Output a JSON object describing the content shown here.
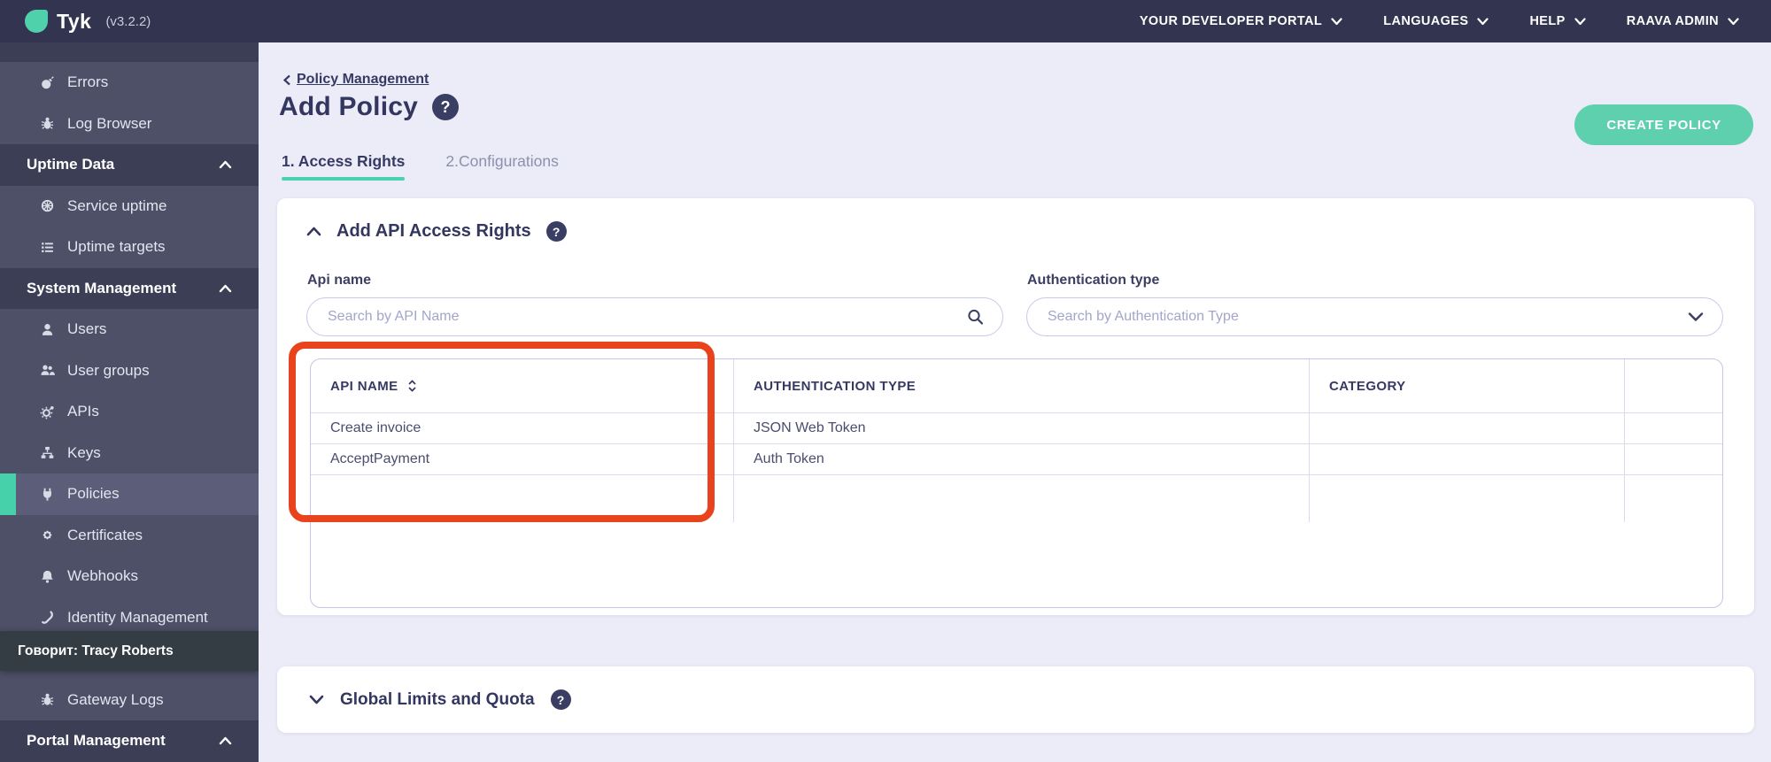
{
  "topbar": {
    "logo_text": "Tyk",
    "version": "(v3.2.2)",
    "nav": [
      "YOUR DEVELOPER PORTAL",
      "LANGUAGES",
      "HELP",
      "RAAVA ADMIN"
    ]
  },
  "sidebar": {
    "items": [
      {
        "type": "item",
        "icon": "bomb",
        "label": "Errors"
      },
      {
        "type": "item",
        "icon": "bug",
        "label": "Log Browser"
      },
      {
        "type": "section",
        "label": "Uptime Data"
      },
      {
        "type": "item",
        "icon": "wheel",
        "label": "Service uptime"
      },
      {
        "type": "item",
        "icon": "list",
        "label": "Uptime targets"
      },
      {
        "type": "section",
        "label": "System Management"
      },
      {
        "type": "item",
        "icon": "user",
        "label": "Users"
      },
      {
        "type": "item",
        "icon": "users",
        "label": "User groups"
      },
      {
        "type": "item",
        "icon": "gear",
        "label": "APIs"
      },
      {
        "type": "item",
        "icon": "sitemap",
        "label": "Keys"
      },
      {
        "type": "item",
        "icon": "plug",
        "label": "Policies",
        "active": true
      },
      {
        "type": "item",
        "icon": "certificate",
        "label": "Certificates"
      },
      {
        "type": "item",
        "icon": "bell",
        "label": "Webhooks"
      },
      {
        "type": "item",
        "icon": "phone",
        "label": "Identity Management"
      },
      {
        "type": "spacer"
      },
      {
        "type": "item",
        "icon": "bug",
        "label": "Gateway Logs"
      },
      {
        "type": "section",
        "label": "Portal Management"
      }
    ],
    "caption": "Говорит: Tracy Roberts"
  },
  "page": {
    "breadcrumb": "Policy Management",
    "title": "Add Policy",
    "create_button": "CREATE POLICY",
    "tabs": [
      {
        "label": "1. Access Rights",
        "active": true
      },
      {
        "label": "2.Configurations",
        "active": false
      }
    ]
  },
  "access_rights": {
    "heading": "Add API Access Rights",
    "api_name_label": "Api name",
    "api_name_placeholder": "Search by API Name",
    "auth_type_label": "Authentication type",
    "auth_type_placeholder": "Search by Authentication Type",
    "table": {
      "columns": [
        "API NAME",
        "AUTHENTICATION TYPE",
        "CATEGORY",
        ""
      ],
      "rows": [
        {
          "api_name": "Create invoice",
          "auth_type": "JSON Web Token",
          "category": ""
        },
        {
          "api_name": "AcceptPayment",
          "auth_type": "Auth Token",
          "category": ""
        }
      ]
    }
  },
  "global_limits": {
    "heading": "Global Limits and Quota"
  },
  "colors": {
    "accent_teal": "#4fd1ac",
    "annotation_red": "#e9431d",
    "navy_text": "#363963"
  }
}
